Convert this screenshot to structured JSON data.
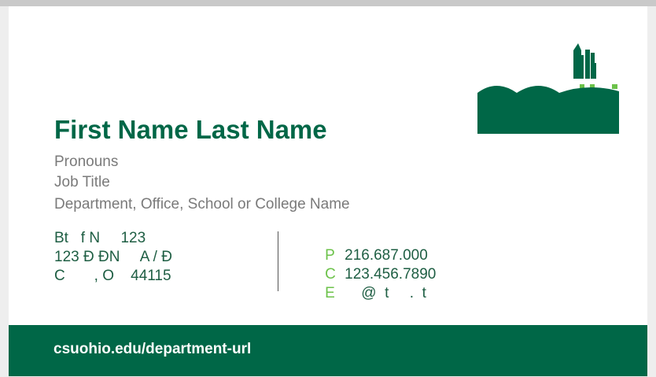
{
  "card": {
    "name": "First Name Last Name",
    "pronouns": "Pronouns",
    "job_title": "Job Title",
    "department": "Department, Office, School or College Name",
    "address": [
      "Bt   f N     123",
      "123 Ð ÐN     A / Ð",
      "C       , O    44115"
    ],
    "contacts": [
      {
        "key": "P",
        "value": "216.687.000"
      },
      {
        "key": "C",
        "value": "123.456.7890"
      },
      {
        "key": "E",
        "value": "    @  t     .  t"
      }
    ],
    "url": "csuohio.edu/department-url"
  },
  "colors": {
    "brand_green": "#006747",
    "accent_green": "#6cc24a",
    "text_gray": "#7a7a7a"
  },
  "logo": {
    "icon": "skyline-logo-icon"
  }
}
